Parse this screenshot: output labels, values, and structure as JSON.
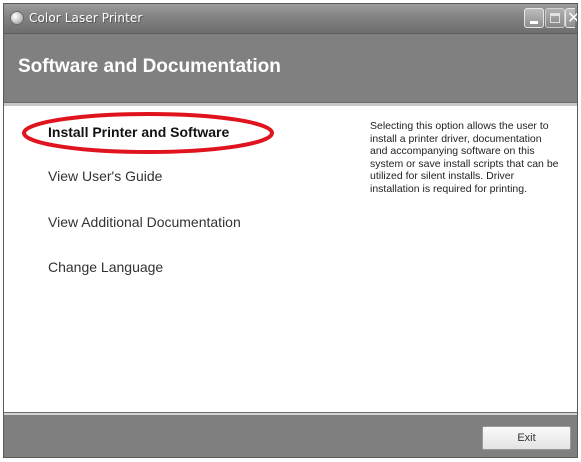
{
  "window": {
    "title": "Color Laser Printer",
    "controls": {
      "minimize_icon": "minimize-icon",
      "maximize_icon": "maximize-icon",
      "close_icon": "close-icon",
      "close_glyph": "✕"
    }
  },
  "header": {
    "title": "Software and Documentation"
  },
  "menu": {
    "items": [
      {
        "label": "Install Printer and Software",
        "selected": true
      },
      {
        "label": "View User's Guide",
        "selected": false
      },
      {
        "label": "View Additional Documentation",
        "selected": false
      },
      {
        "label": "Change Language",
        "selected": false
      }
    ],
    "highlight_color": "#e0141e"
  },
  "description": {
    "text": "Selecting this option allows the user to install a printer driver, documentation and accompanying software on this system or save install scripts that can be utilized for silent installs. Driver installation is required for printing."
  },
  "footer": {
    "exit_label": "Exit"
  },
  "colors": {
    "header_bg": "#808080",
    "content_bg": "#ffffff",
    "annotation_red": "#e0141e"
  }
}
